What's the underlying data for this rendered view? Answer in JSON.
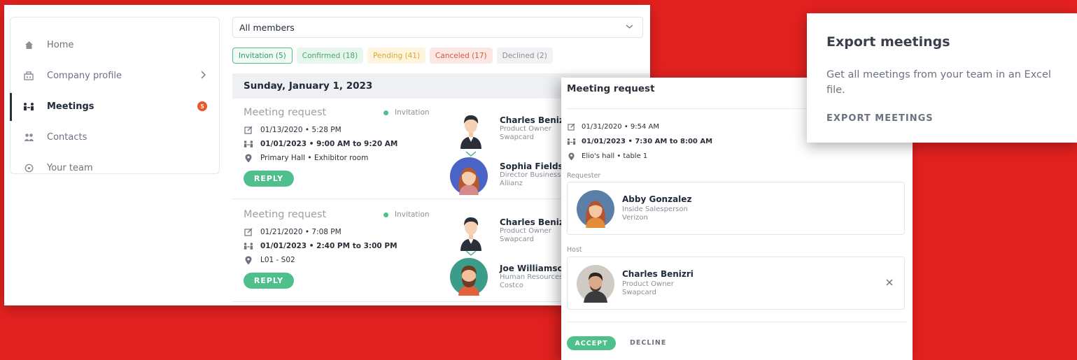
{
  "sidebar": {
    "items": [
      {
        "label": "Home",
        "icon": "home-icon"
      },
      {
        "label": "Company profile",
        "icon": "company-icon"
      },
      {
        "label": "Meetings",
        "icon": "meetings-icon",
        "badge": "5"
      },
      {
        "label": "Contacts",
        "icon": "contacts-icon"
      },
      {
        "label": "Your team",
        "icon": "team-icon"
      }
    ]
  },
  "filter": {
    "member_select": "All members"
  },
  "tabs": [
    {
      "label": "Invitation (5)"
    },
    {
      "label": "Confirmed (18)"
    },
    {
      "label": "Pending (41)"
    },
    {
      "label": "Canceled (17)"
    },
    {
      "label": "Declined (2)"
    }
  ],
  "day_header": "Sunday, January 1, 2023",
  "meetings": [
    {
      "title": "Meeting request",
      "status": "Invitation",
      "created": "01/13/2020 • 5:28 PM",
      "slot": "01/01/2023 • 9:00 AM to 9:20 AM",
      "location": "Primary Hall • Exhibitor room",
      "reply_label": "REPLY",
      "host": {
        "name": "Charles Benizri",
        "role": "Product Owner",
        "company": "Swapcard"
      },
      "guest": {
        "name": "Sophia Fields",
        "role": "Director Business",
        "company": "Allianz"
      }
    },
    {
      "title": "Meeting request",
      "status": "Invitation",
      "created": "01/21/2020 • 7:08 PM",
      "slot": "01/01/2023 • 2:40 PM to 3:00 PM",
      "location": "L01 - S02",
      "reply_label": "REPLY",
      "host": {
        "name": "Charles Benizri",
        "role": "Product Owner",
        "company": "Swapcard"
      },
      "guest": {
        "name": "Joe Williamson",
        "role": "Human Resources",
        "company": "Costco"
      }
    }
  ],
  "request_panel": {
    "title": "Meeting request",
    "created": "01/31/2020 • 9:54 AM",
    "slot": "01/01/2023 • 7:30 AM to 8:00 AM",
    "location": "Elio's hall • table 1",
    "requester_label": "Requester",
    "requester": {
      "name": "Abby Gonzalez",
      "role": "Inside Salesperson",
      "company": "Verizon"
    },
    "host_label": "Host",
    "host": {
      "name": "Charles Benizri",
      "role": "Product Owner",
      "company": "Swapcard"
    },
    "accept_label": "ACCEPT",
    "decline_label": "DECLINE"
  },
  "export_panel": {
    "title": "Export meetings",
    "description": "Get all meetings from your team in an Excel file.",
    "link_label": "EXPORT MEETINGS"
  },
  "colors": {
    "background": "#e1211f",
    "accent_green": "#4fbf8b",
    "badge_orange": "#e8582a"
  }
}
